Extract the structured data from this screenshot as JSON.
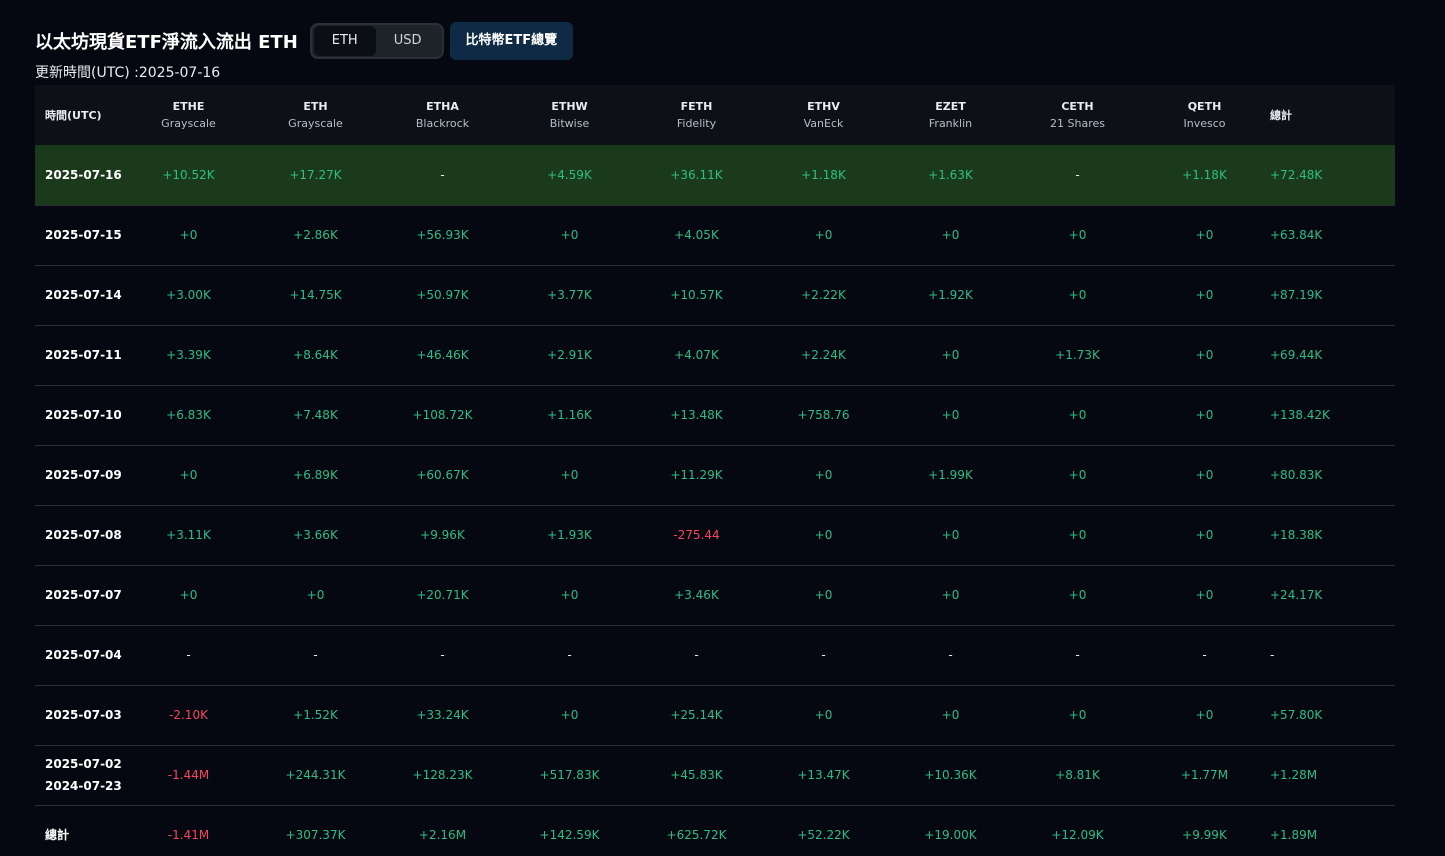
{
  "header": {
    "title": "以太坊現貨ETF淨流入流出 ETH",
    "toggle": [
      "ETH",
      "USD"
    ],
    "toggle_active": "ETH",
    "btc_button": "比特幣ETF總覽",
    "updated": "更新時間(UTC) :2025-07-16"
  },
  "colors": {
    "positive": "#2ebd85",
    "negative": "#f6465d",
    "highlight_row": "#1b3a1c"
  },
  "table": {
    "date_header": "時間(UTC)",
    "total_header": "總計",
    "columns": [
      {
        "ticker": "ETHE",
        "issuer": "Grayscale"
      },
      {
        "ticker": "ETH",
        "issuer": "Grayscale"
      },
      {
        "ticker": "ETHA",
        "issuer": "Blackrock"
      },
      {
        "ticker": "ETHW",
        "issuer": "Bitwise"
      },
      {
        "ticker": "FETH",
        "issuer": "Fidelity"
      },
      {
        "ticker": "ETHV",
        "issuer": "VanEck"
      },
      {
        "ticker": "EZET",
        "issuer": "Franklin"
      },
      {
        "ticker": "CETH",
        "issuer": "21 Shares"
      },
      {
        "ticker": "QETH",
        "issuer": "Invesco"
      }
    ],
    "rows": [
      {
        "date": "2025-07-16",
        "values": [
          "+10.52K",
          "+17.27K",
          "-",
          "+4.59K",
          "+36.11K",
          "+1.18K",
          "+1.63K",
          "-",
          "+1.18K"
        ],
        "total": "+72.48K",
        "highlight": true
      },
      {
        "date": "2025-07-15",
        "values": [
          "+0",
          "+2.86K",
          "+56.93K",
          "+0",
          "+4.05K",
          "+0",
          "+0",
          "+0",
          "+0"
        ],
        "total": "+63.84K"
      },
      {
        "date": "2025-07-14",
        "values": [
          "+3.00K",
          "+14.75K",
          "+50.97K",
          "+3.77K",
          "+10.57K",
          "+2.22K",
          "+1.92K",
          "+0",
          "+0"
        ],
        "total": "+87.19K"
      },
      {
        "date": "2025-07-11",
        "values": [
          "+3.39K",
          "+8.64K",
          "+46.46K",
          "+2.91K",
          "+4.07K",
          "+2.24K",
          "+0",
          "+1.73K",
          "+0"
        ],
        "total": "+69.44K"
      },
      {
        "date": "2025-07-10",
        "values": [
          "+6.83K",
          "+7.48K",
          "+108.72K",
          "+1.16K",
          "+13.48K",
          "+758.76",
          "+0",
          "+0",
          "+0"
        ],
        "total": "+138.42K"
      },
      {
        "date": "2025-07-09",
        "values": [
          "+0",
          "+6.89K",
          "+60.67K",
          "+0",
          "+11.29K",
          "+0",
          "+1.99K",
          "+0",
          "+0"
        ],
        "total": "+80.83K"
      },
      {
        "date": "2025-07-08",
        "values": [
          "+3.11K",
          "+3.66K",
          "+9.96K",
          "+1.93K",
          "-275.44",
          "+0",
          "+0",
          "+0",
          "+0"
        ],
        "total": "+18.38K"
      },
      {
        "date": "2025-07-07",
        "values": [
          "+0",
          "+0",
          "+20.71K",
          "+0",
          "+3.46K",
          "+0",
          "+0",
          "+0",
          "+0"
        ],
        "total": "+24.17K"
      },
      {
        "date": "2025-07-04",
        "values": [
          "-",
          "-",
          "-",
          "-",
          "-",
          "-",
          "-",
          "-",
          "-"
        ],
        "total": "-"
      },
      {
        "date": "2025-07-03",
        "values": [
          "-2.10K",
          "+1.52K",
          "+33.24K",
          "+0",
          "+25.14K",
          "+0",
          "+0",
          "+0",
          "+0"
        ],
        "total": "+57.80K"
      },
      {
        "date": "2025-07-02",
        "date2": "2024-07-23",
        "values": [
          "-1.44M",
          "+244.31K",
          "+128.23K",
          "+517.83K",
          "+45.83K",
          "+13.47K",
          "+10.36K",
          "+8.81K",
          "+1.77M"
        ],
        "total": "+1.28M"
      },
      {
        "date": "總計",
        "values": [
          "-1.41M",
          "+307.37K",
          "+2.16M",
          "+142.59K",
          "+625.72K",
          "+52.22K",
          "+19.00K",
          "+12.09K",
          "+9.99K"
        ],
        "total": "+1.89M",
        "last": true
      }
    ]
  }
}
